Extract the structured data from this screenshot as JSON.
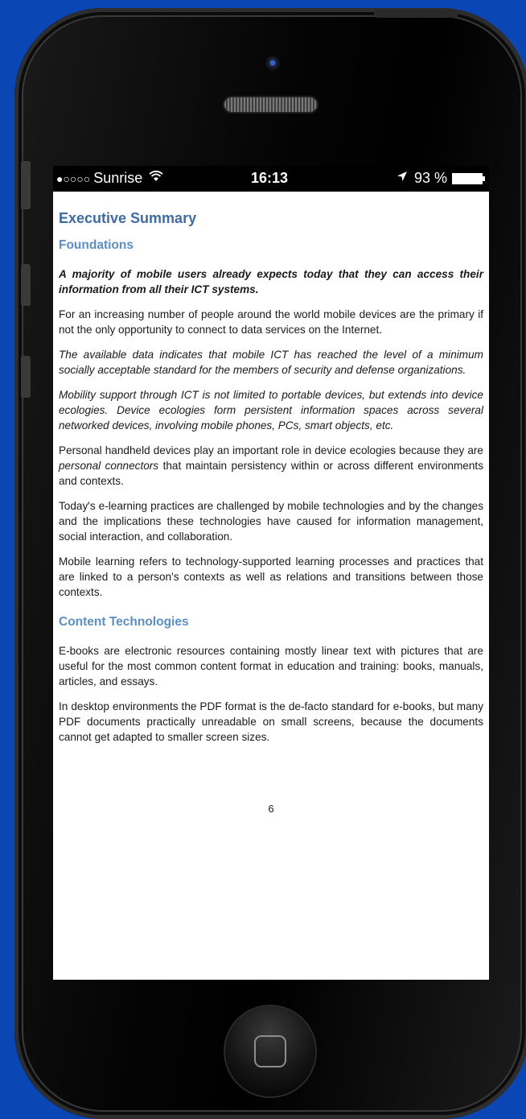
{
  "status_bar": {
    "signal": "●○○○○",
    "carrier": "Sunrise",
    "wifi_icon": "wifi-icon",
    "time": "16:13",
    "location_icon": "location-arrow-icon",
    "battery_percent": "93 %",
    "battery_level": 0.93
  },
  "document": {
    "title": "Executive Summary",
    "sections": [
      {
        "heading": "Foundations",
        "paragraphs": [
          "A majority of mobile users already expects today that they can access their information from all their ICT systems.",
          "For an increasing number of people around the world mobile devices are the primary if not the only opportunity to connect to data services on the Internet.",
          "The available data indicates that mobile ICT has reached the level of a minimum socially acceptable standard for the members of security and defense organizations.",
          "Mobility support through ICT is not limited to portable devices, but extends into device ecologies. Device ecologies form persistent information spaces across several networked devices, involving mobile phones, PCs, smart objects, etc.",
          {
            "before": "Personal handheld devices play an important role in device ecologies because they are ",
            "emphasis": "personal connectors",
            "after": " that maintain persistency within or across different environments and contexts."
          },
          "Today's e-learning practices are challenged by mobile technologies and by the changes and the implications these technologies have caused for information management, social interaction, and collaboration.",
          "Mobile learning refers to technology-supported learning processes and practices that are linked to a person's contexts as well as relations and transitions between those contexts."
        ]
      },
      {
        "heading": "Content Technologies",
        "paragraphs": [
          "E-books are electronic resources containing mostly linear text with pictures that are useful for the most common content format in education and training: books, manuals, articles, and essays.",
          "In desktop environments the PDF format is the de-facto standard for e-books, but many PDF documents practically unreadable on small screens, because the documents cannot get adapted to smaller screen sizes."
        ]
      }
    ],
    "page_number": "6"
  },
  "colors": {
    "background": "#0a46b4",
    "title": "#3d6ba6",
    "heading": "#5a8fcd"
  }
}
